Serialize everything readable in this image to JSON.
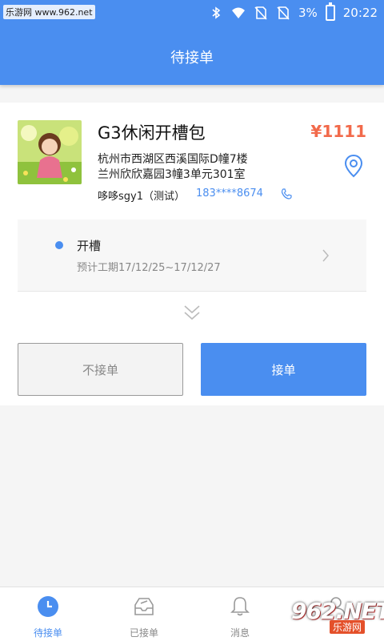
{
  "status_bar": {
    "watermark": "乐游网 www.962.net",
    "battery": "3%",
    "time": "20:22"
  },
  "header": {
    "title": "待接单"
  },
  "order": {
    "product_name": "G3休闲开槽包",
    "price": "¥1111",
    "address_line1": "杭州市西湖区西溪国际D幢7楼",
    "address_line2": "兰州欣欣嘉园3幢3单元301室",
    "contact_name": "哆哆sgy1（测试）",
    "contact_phone": "183****8674",
    "task": {
      "name": "开槽",
      "period": "预计工期17/12/25~17/12/27"
    },
    "buttons": {
      "reject": "不接单",
      "accept": "接单"
    }
  },
  "bottom_nav": {
    "items": [
      {
        "label": "待接单",
        "icon": "clock-icon",
        "active": true
      },
      {
        "label": "已接单",
        "icon": "inbox-icon",
        "active": false
      },
      {
        "label": "消息",
        "icon": "bell-icon",
        "active": false
      },
      {
        "label": "",
        "icon": "user-icon",
        "active": false
      }
    ]
  },
  "overlay_logo": {
    "number": "962.NET",
    "text": "乐游网"
  },
  "colors": {
    "primary": "#4a8ef0",
    "price": "#f26a4b"
  }
}
